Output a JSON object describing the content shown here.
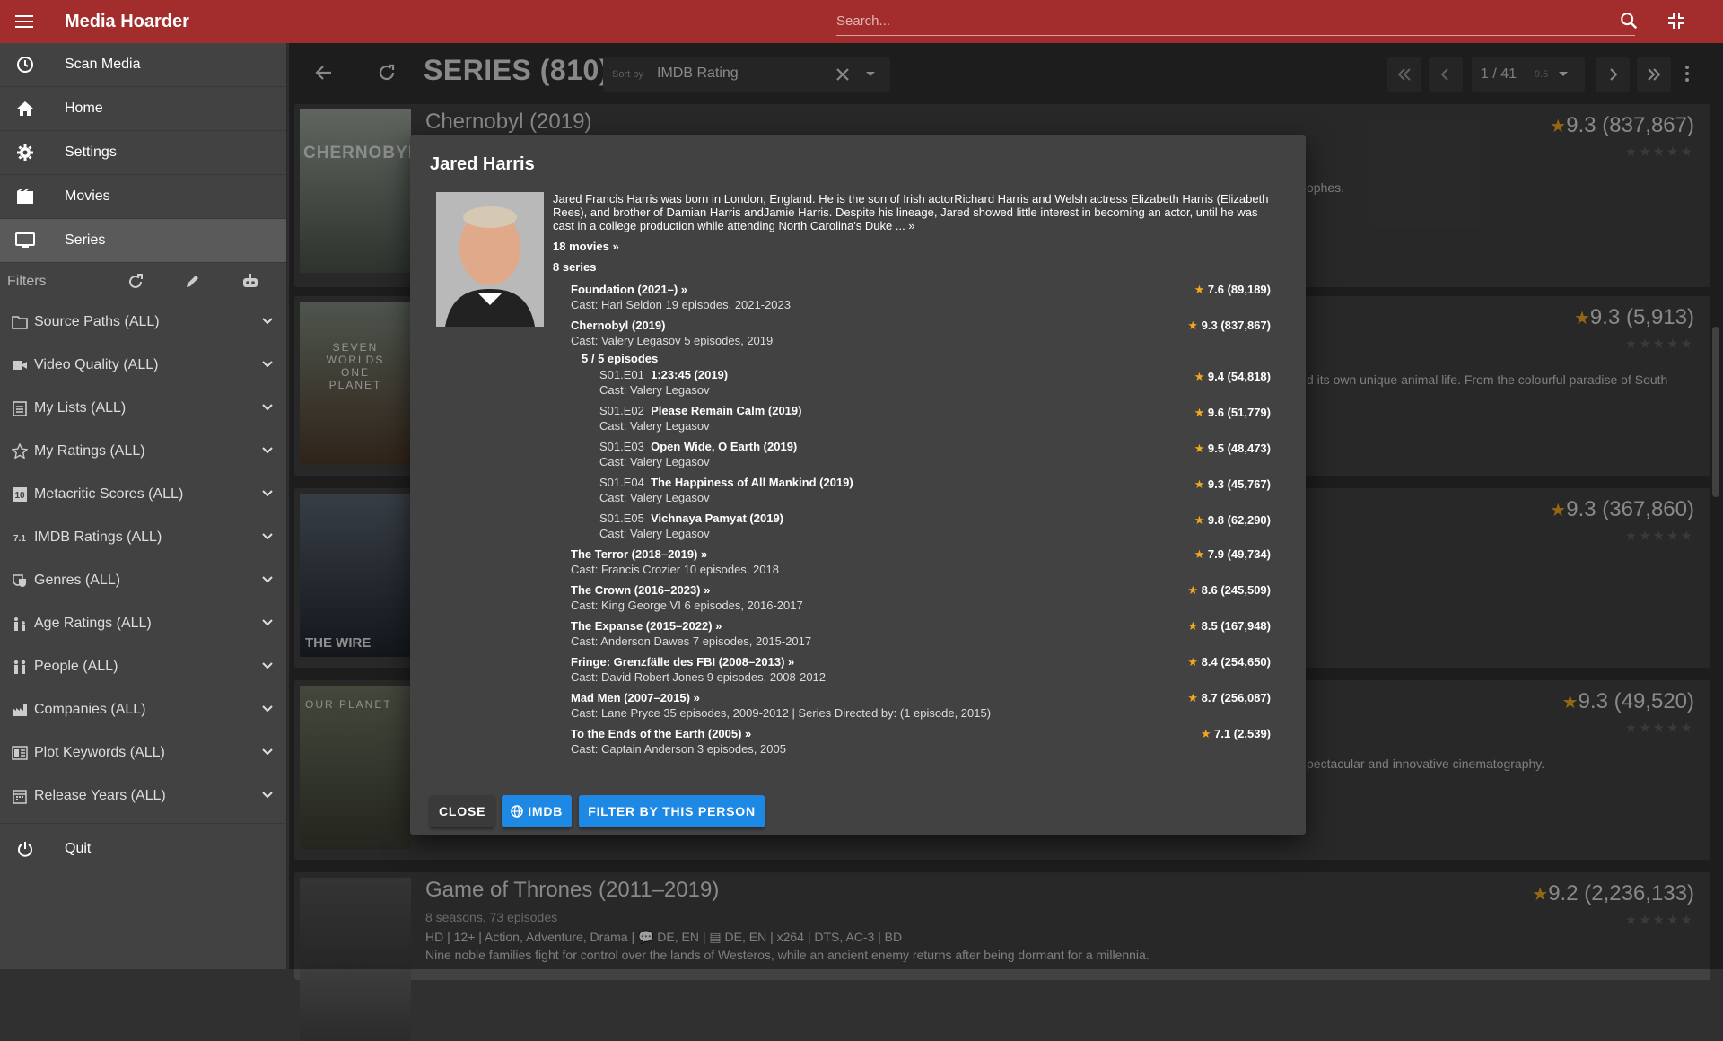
{
  "app": {
    "title": "Media Hoarder"
  },
  "search": {
    "placeholder": "Search..."
  },
  "sidebar": {
    "nav": [
      {
        "label": "Scan Media",
        "icon": "scan-icon"
      },
      {
        "label": "Home",
        "icon": "home-icon"
      },
      {
        "label": "Settings",
        "icon": "gear-icon"
      },
      {
        "label": "Movies",
        "icon": "movie-icon"
      },
      {
        "label": "Series",
        "icon": "tv-icon"
      }
    ],
    "filters_label": "Filters",
    "filters": [
      {
        "label": "Source Paths (ALL)",
        "icon": "folder-icon"
      },
      {
        "label": "Video Quality (ALL)",
        "icon": "video-camera-icon"
      },
      {
        "label": "My Lists (ALL)",
        "icon": "clipboard-list-icon"
      },
      {
        "label": "My Ratings (ALL)",
        "icon": "star-icon"
      },
      {
        "label": "Metacritic Scores (ALL)",
        "icon": "metacritic-icon"
      },
      {
        "label": "IMDB Ratings (ALL)",
        "icon": "imdb-rating-icon"
      },
      {
        "label": "Genres (ALL)",
        "icon": "drama-mask-icon"
      },
      {
        "label": "Age Ratings (ALL)",
        "icon": "age-rating-icon"
      },
      {
        "label": "People (ALL)",
        "icon": "people-icon"
      },
      {
        "label": "Companies (ALL)",
        "icon": "factory-icon"
      },
      {
        "label": "Plot Keywords (ALL)",
        "icon": "keywords-icon"
      },
      {
        "label": "Release Years (ALL)",
        "icon": "calendar-icon"
      }
    ],
    "quit_label": "Quit",
    "imdb_badge": "7.1",
    "metacritic_badge": "10"
  },
  "toolbar": {
    "title": "SERIES (810)",
    "sort_label": "Sort by",
    "sort_value": "IMDB Rating",
    "page": "1 / 41",
    "page_marker": "9.5"
  },
  "cards": [
    {
      "title": "Chernobyl (2019)",
      "rating": "9.3 (837,867)",
      "desc_fragment": "ophes.",
      "poster_text": "CHERNOBYL"
    },
    {
      "title": "",
      "rating": "9.3 (5,913)",
      "desc_fragment": "d its own unique animal life. From the colourful paradise of South",
      "poster_text": "SEVEN WORLDS ONE PLANET"
    },
    {
      "title": "",
      "rating": "9.3 (367,860)",
      "desc_fragment": "",
      "poster_text": "THE WIRE"
    },
    {
      "title": "",
      "rating": "9.3 (49,520)",
      "desc_fragment": "pectacular and innovative cinematography.",
      "poster_text": "OUR PLANET"
    },
    {
      "title": "Game of Thrones (2011–2019)",
      "rating": "9.2 (2,236,133)",
      "subtitle": "8 seasons, 73 episodes",
      "meta": "HD | 12+ | Action, Adventure, Drama | 💬 DE, EN | ▤ DE, EN | x264 | DTS, AC-3 | BD",
      "desc": "Nine noble families fight for control over the lands of Westeros, while an ancient enemy returns after being dormant for a millennia."
    }
  ],
  "dialog": {
    "name": "Jared Harris",
    "bio": "Jared Francis Harris was born in London, England. He is the son of Irish actorRichard Harris and Welsh actress Elizabeth Harris (Elizabeth Rees), and brother of Damian Harris andJamie Harris. Despite his lineage, Jared showed little interest in becoming an actor, until he was cast in a college production while attending North Carolina's Duke ... »",
    "movies_link": "18 movies »",
    "series_count": "8 series",
    "episodes_head": "5 / 5 episodes",
    "credits": [
      {
        "title": "Foundation (2021–) »",
        "cast": "Cast: Hari Seldon 19 episodes, 2021-2023",
        "rating": "7.6 (89,189)"
      },
      {
        "title": "Chernobyl (2019)",
        "cast": "Cast: Valery Legasov 5 episodes, 2019",
        "rating": "9.3 (837,867)"
      },
      {
        "title": "The Terror (2018–2019) »",
        "cast": "Cast: Francis Crozier 10 episodes, 2018",
        "rating": "7.9 (49,734)"
      },
      {
        "title": "The Crown (2016–2023) »",
        "cast": "Cast: King George VI 6 episodes, 2016-2017",
        "rating": "8.6 (245,509)"
      },
      {
        "title": "The Expanse (2015–2022) »",
        "cast": "Cast: Anderson Dawes 7 episodes, 2015-2017",
        "rating": "8.5 (167,948)"
      },
      {
        "title": "Fringe: Grenzfälle des FBI (2008–2013) »",
        "cast": "Cast: David Robert Jones 9 episodes, 2008-2012",
        "rating": "8.4 (254,650)"
      },
      {
        "title": "Mad Men (2007–2015) »",
        "cast": "Cast: Lane Pryce 35 episodes, 2009-2012 | Series Directed by: (1 episode, 2015)",
        "rating": "8.7 (256,087)"
      },
      {
        "title": "To the Ends of the Earth (2005) »",
        "cast": "Cast: Captain Anderson 3 episodes, 2005",
        "rating": "7.1 (2,539)"
      }
    ],
    "episodes": [
      {
        "code": "S01.E01",
        "title": "1:23:45 (2019)",
        "cast": "Cast: Valery Legasov",
        "rating": "9.4 (54,818)"
      },
      {
        "code": "S01.E02",
        "title": "Please Remain Calm (2019)",
        "cast": "Cast: Valery Legasov",
        "rating": "9.6 (51,779)"
      },
      {
        "code": "S01.E03",
        "title": "Open Wide, O Earth (2019)",
        "cast": "Cast: Valery Legasov",
        "rating": "9.5 (48,473)"
      },
      {
        "code": "S01.E04",
        "title": "The Happiness of All Mankind (2019)",
        "cast": "Cast: Valery Legasov",
        "rating": "9.3 (45,767)"
      },
      {
        "code": "S01.E05",
        "title": "Vichnaya Pamyat (2019)",
        "cast": "Cast: Valery Legasov",
        "rating": "9.8 (62,290)"
      }
    ],
    "actions": {
      "close": "CLOSE",
      "imdb": "IMDB",
      "filter": "FILTER BY THIS PERSON"
    }
  },
  "colors": {
    "topbar": "#a32d2c",
    "accent_blue": "#1e88e5",
    "star": "#f2a71f",
    "panel": "#424242"
  }
}
